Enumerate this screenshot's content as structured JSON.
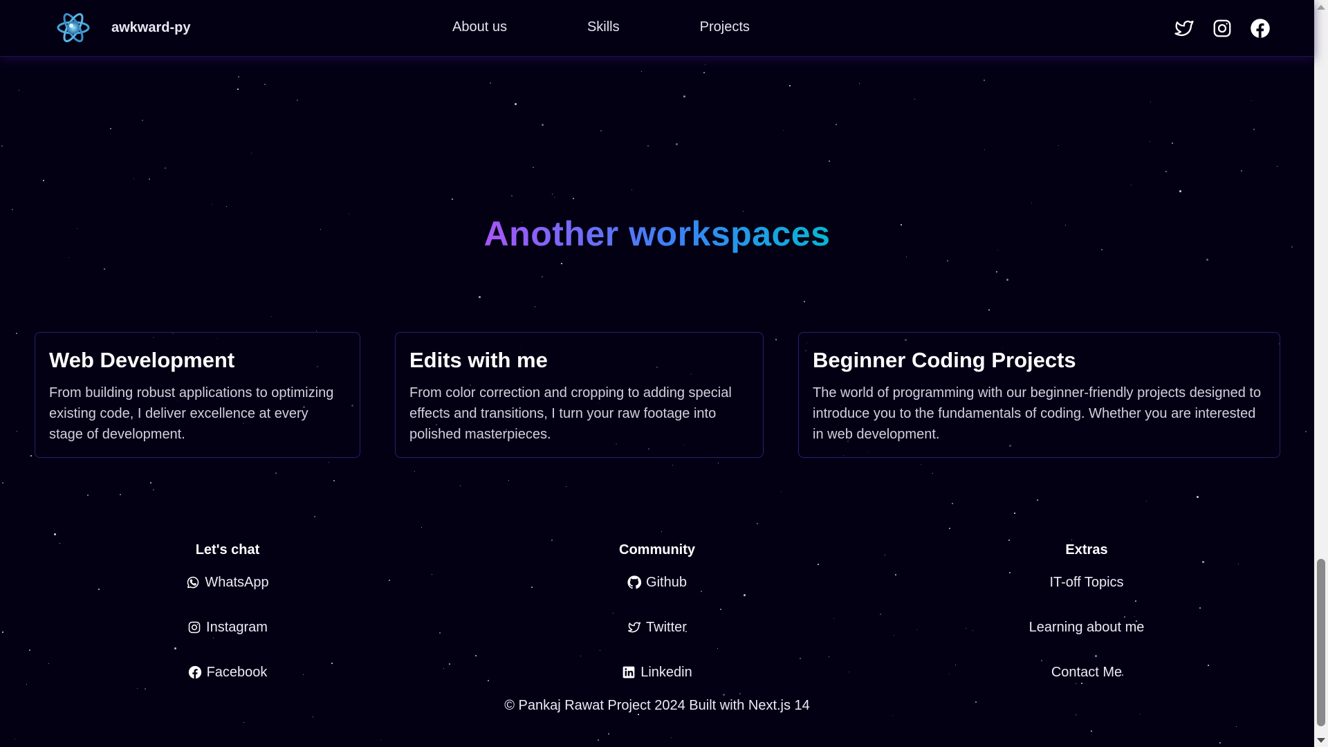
{
  "header": {
    "brand_name": "awkward-py",
    "nav": [
      {
        "label": "About us"
      },
      {
        "label": "Skills"
      },
      {
        "label": "Projects"
      }
    ],
    "socials": [
      "twitter-icon",
      "instagram-icon",
      "facebook-icon"
    ]
  },
  "section": {
    "title_part1": "Another",
    "title_part2": "workspaces"
  },
  "cards": [
    {
      "title": "Web Development",
      "description": "From building robust applications to optimizing existing code, I deliver excellence at every stage of development."
    },
    {
      "title": "Edits with me",
      "description": "From color correction and cropping to adding special effects and transitions, I turn your raw footage into polished masterpieces."
    },
    {
      "title": "Beginner Coding Projects",
      "description": "The world of programming with our beginner-friendly projects designed to introduce you to the fundamentals of coding. Whether you are interested in web development."
    }
  ],
  "footer": {
    "columns": [
      {
        "heading": "Let's chat",
        "links": [
          {
            "label": "WhatsApp",
            "icon": "whatsapp-icon"
          },
          {
            "label": "Instagram",
            "icon": "instagram-icon"
          },
          {
            "label": "Facebook",
            "icon": "facebook-icon"
          }
        ]
      },
      {
        "heading": "Community",
        "links": [
          {
            "label": "Github",
            "icon": "github-icon"
          },
          {
            "label": "Twitter",
            "icon": "twitter-icon"
          },
          {
            "label": "Linkedin",
            "icon": "linkedin-icon"
          }
        ]
      },
      {
        "heading": "Extras",
        "links": [
          {
            "label": "IT-off Topics"
          },
          {
            "label": "Learning about me"
          },
          {
            "label": "Contact Me"
          }
        ]
      }
    ],
    "copyright": "© Pankaj Rawat Project 2024 Built with Next.js 14"
  },
  "colors": {
    "background": "#030014",
    "card_border": "#2a1f6e",
    "gradient_start": "#a855f7",
    "gradient_mid": "#3b82f6",
    "gradient_end": "#06b6d4"
  }
}
